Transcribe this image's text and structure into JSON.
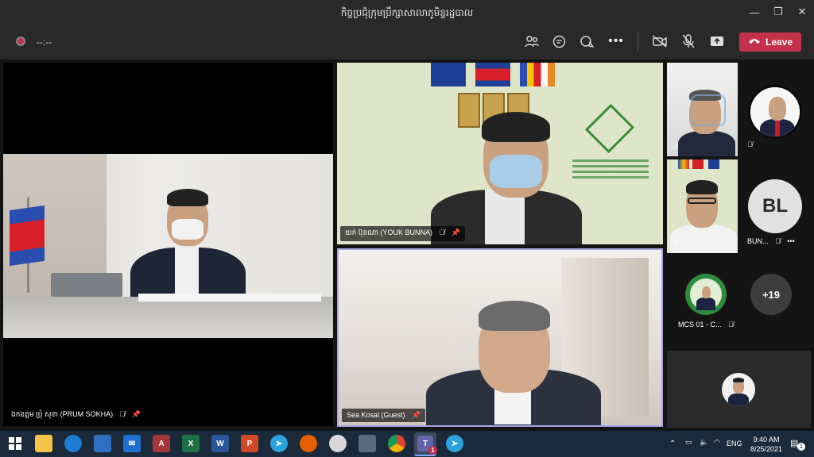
{
  "window": {
    "title": "កិច្ចប្រជុំក្រុមប្រឹក្សាសាលាភូមិន្ទរដ្ឋបាល",
    "minimize_glyph": "—",
    "maximize_glyph": "❐",
    "close_glyph": "✕"
  },
  "toolbar": {
    "recording_timer": "--:--",
    "leave_label": "Leave",
    "icons": [
      "participants-icon",
      "chat-icon",
      "reactions-icon",
      "more-icon",
      "camera-off-icon",
      "mic-off-icon",
      "share-icon",
      "phone-icon"
    ]
  },
  "participants": {
    "main": {
      "name": "ឯកឧត្តម ប្រុំ សុខា (PRUM SOKHA)"
    },
    "top_right": {
      "name": "យក់ ប៊ុនណា (YOUK BUNNA)"
    },
    "bottom_right": {
      "name": "Sea Kosal (Guest)"
    },
    "side_bun": {
      "initials": "BL",
      "name": "BUN..."
    },
    "side_mcs": {
      "name": "MCS 01 - C..."
    },
    "overflow_count": "+19"
  },
  "taskbar": {
    "time": "9:40 AM",
    "date": "8/25/2021",
    "language": "ENG",
    "teams_badge": "1",
    "notification_badge": "1",
    "apps": [
      "windows-start",
      "file-explorer",
      "edge",
      "store",
      "mail",
      "access",
      "excel",
      "word",
      "powerpoint",
      "telegram",
      "firefox",
      "app-8",
      "camera",
      "chrome",
      "teams",
      "telegram-2"
    ]
  },
  "colors": {
    "accent": "#c4314b",
    "active_border": "#a9a4e8",
    "teams_purple": "#6264a7"
  }
}
